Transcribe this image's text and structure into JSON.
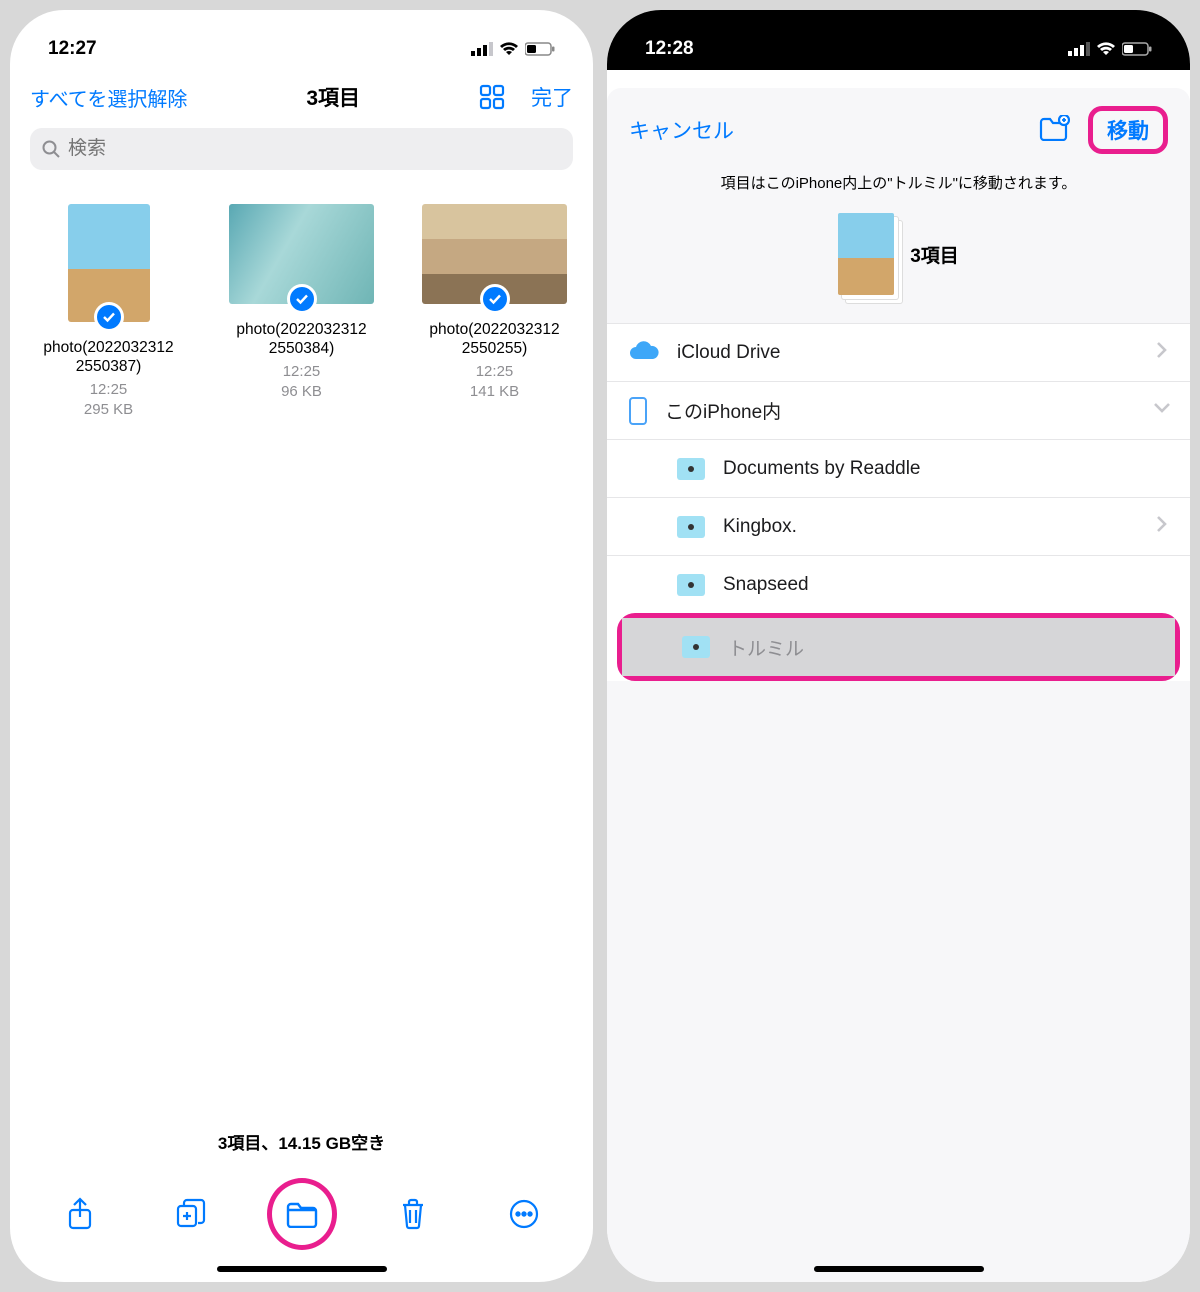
{
  "left": {
    "status_time": "12:27",
    "nav": {
      "deselect": "すべてを選択解除",
      "count": "3項目",
      "done": "完了"
    },
    "search_placeholder": "検索",
    "files": [
      {
        "name": "photo(2022032312 2550387)",
        "time": "12:25",
        "size": "295 KB"
      },
      {
        "name": "photo(2022032312 2550384)",
        "time": "12:25",
        "size": "96 KB"
      },
      {
        "name": "photo(2022032312 2550255)",
        "time": "12:25",
        "size": "141 KB"
      }
    ],
    "status_text": "3項目、14.15 GB空き"
  },
  "right": {
    "status_time": "12:28",
    "nav": {
      "cancel": "キャンセル",
      "move": "移動"
    },
    "hint": "項目はこのiPhone内上の\"トルミル\"に移動されます。",
    "preview_count": "3項目",
    "locations": {
      "icloud": "iCloud Drive",
      "this_iphone": "このiPhone内",
      "subs": [
        {
          "label": "Documents by Readdle"
        },
        {
          "label": "Kingbox."
        },
        {
          "label": "Snapseed"
        },
        {
          "label": "トルミル"
        }
      ]
    }
  }
}
